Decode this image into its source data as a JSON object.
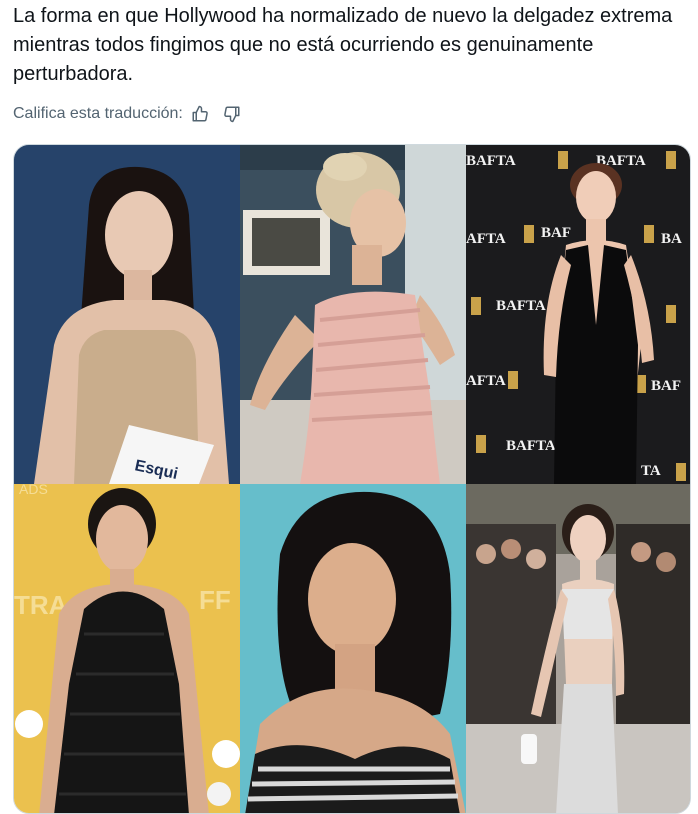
{
  "tweet": {
    "text": "La forma en que Hollywood ha normalizado de nuevo la delgadez extrema mientras todos fingimos que no está ocurriendo es genuinamente perturbadora."
  },
  "translation_rating": {
    "label": "Califica esta traducción:",
    "thumbs_up_icon": "thumbs-up-icon",
    "thumbs_down_icon": "thumbs-down-icon"
  },
  "media": {
    "photos": [
      {
        "alt": "Mujer de pelo negro largo con camiseta de tirantes beige sosteniendo un papel",
        "visible_text": "Esqui"
      },
      {
        "alt": "Mujer rubia con vestido rosa de volantes"
      },
      {
        "alt": "Mujer con vestido negro halter frente a fondo BAFTA",
        "visible_text": "BAFTA"
      },
      {
        "alt": "Mujer con vestido negro sin hombros frente a fondo amarillo"
      },
      {
        "alt": "Mujer con pelo rizado negro y top a rayas sobre fondo turquesa"
      },
      {
        "alt": "Mujer con top plateado y falda brillante en la calle"
      }
    ],
    "colors": {
      "border": "#cfd9de",
      "muted_text": "#536471",
      "primary_text": "#0f1419"
    }
  }
}
